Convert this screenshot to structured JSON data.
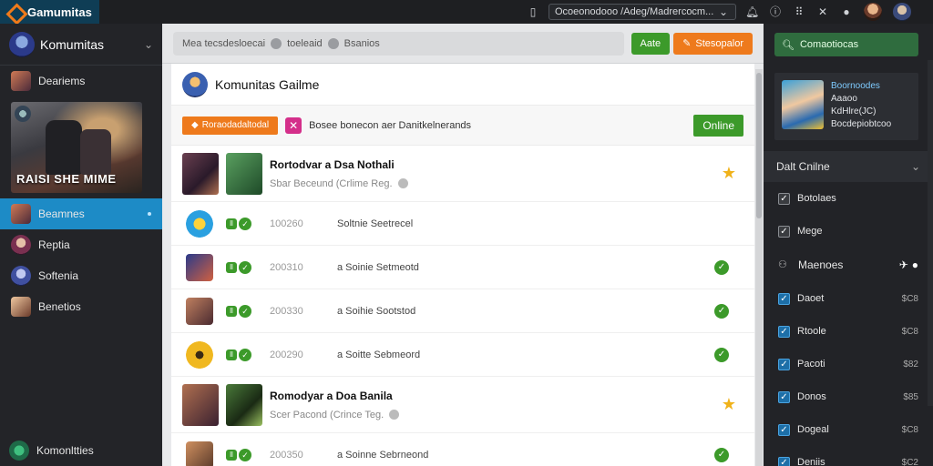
{
  "app": {
    "name": "Gamumitas"
  },
  "topbar": {
    "url": "Ocoeonodooo /Adeg/Madrercocm..."
  },
  "sidebar": {
    "title": "Komumitas",
    "items": [
      {
        "label": "Deariems"
      },
      {
        "label": "Beamnes",
        "active": true
      },
      {
        "label": "Reptia"
      },
      {
        "label": "Softenia"
      },
      {
        "label": "Benetios"
      }
    ],
    "banner_text": "RAISI SHE MIME",
    "footer": "Komonltties"
  },
  "toolbar": {
    "filter_text": "Mea tecsdesloecai",
    "chip1": "toeleaid",
    "chip2": "Bsanios",
    "btn_green": "Aate",
    "btn_orange": "Stesopalor"
  },
  "panel": {
    "title": "Komunitas Gailme",
    "alert": {
      "button": "Roraodadaltodal",
      "text": "Bosee bonecon aer Danitkelnerands",
      "online": "Online"
    },
    "rows": [
      {
        "kind": "big",
        "title": "Rortodvar a Dsa Nothali",
        "sub": "Sbar Beceund (Crlime Reg."
      },
      {
        "kind": "small",
        "num": "100260",
        "label": "Soltnie Seetrecel"
      },
      {
        "kind": "small",
        "num": "200310",
        "label": "a Soinie Setmeotd"
      },
      {
        "kind": "small",
        "num": "200330",
        "label": "a Soihie Sootstod"
      },
      {
        "kind": "small",
        "num": "200290",
        "label": "a Soitte Sebmeord"
      },
      {
        "kind": "big",
        "title": "Romodyar a Doa Banila",
        "sub": "Scer Pacond (Crince Teg."
      },
      {
        "kind": "small",
        "num": "200350",
        "label": "a Soinne Sebrneond"
      }
    ]
  },
  "right": {
    "search": "Comaotiocas",
    "card": {
      "line0": "Boornoodes",
      "line1": "Aaaoo",
      "line2": "KdHlre(JC)",
      "line3": "Bocdepiobtcoo"
    },
    "section": "Dalt Cnilne",
    "checks": [
      {
        "label": "Botolaes"
      },
      {
        "label": "Mege"
      }
    ],
    "subhead": "Maenoes",
    "items": [
      {
        "label": "Daoet",
        "val": "$C8"
      },
      {
        "label": "Rtoole",
        "val": "$C8"
      },
      {
        "label": "Pacoti",
        "val": "$82"
      },
      {
        "label": "Donos",
        "val": "$85"
      },
      {
        "label": "Dogeal",
        "val": "$C8"
      },
      {
        "label": "Deniis",
        "val": "$C2"
      }
    ]
  }
}
